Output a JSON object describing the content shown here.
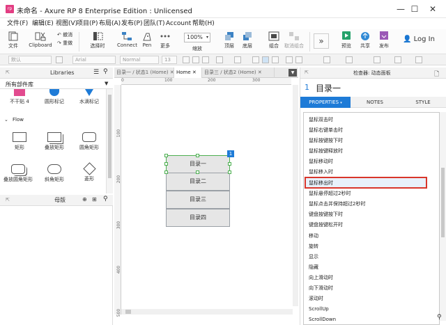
{
  "window": {
    "title": "未命名 - Axure RP 8 Enterprise Edition : Unlicensed",
    "app_icon_text": "rp",
    "minimize": "—",
    "maximize": "☐",
    "close": "✕"
  },
  "menubar": {
    "items": [
      "文件(F)",
      "编辑(E)",
      "视图(V)",
      "项目(P)",
      "布局(A)",
      "发布(P)",
      "团队(T)",
      "Account",
      "帮助(H)"
    ]
  },
  "ribbon": {
    "file": "文件",
    "clipboard": "Clipboard",
    "undo": "撤消",
    "redo": "重做",
    "select": "选择时",
    "connect": "Connect",
    "pen": "Pen",
    "more": "更多",
    "zoom_value": "100%",
    "zoom_label": "缩放",
    "top": "顶层",
    "bottom": "底层",
    "group": "组合",
    "ungroup": "取消组合",
    "preview": "预览",
    "share": "共享",
    "publish": "发布",
    "login": "Log In"
  },
  "formatbar": {
    "style": "默认",
    "font": "Arial",
    "weight": "Normal",
    "size": "13"
  },
  "libraries": {
    "title": "Libraries",
    "dropdown": "所有部件库",
    "top_items": [
      "不干贴 4",
      "圆形标记",
      "水滴标记"
    ],
    "flow_section": "Flow",
    "flow_items": [
      "矩形",
      "叠放矩形",
      "圆角矩形",
      "叠放圆角矩形",
      "斜角矩形",
      "菱形"
    ]
  },
  "masters": {
    "title": "母版"
  },
  "tabs": {
    "items": [
      "目录一 / 状态1 (Home)",
      "Home",
      "目录三 / 状态2 (Home)"
    ],
    "active_index": 1
  },
  "rulers": {
    "top": [
      "0",
      "100",
      "200",
      "300"
    ],
    "left": [
      "100",
      "200",
      "300",
      "400",
      "500"
    ]
  },
  "canvas": {
    "widgets": [
      "目录一",
      "目录二",
      "目录三",
      "目录四"
    ],
    "badge": "1"
  },
  "inspector": {
    "header": "检查器: 动态面板",
    "number": "1",
    "title": "目录一",
    "tabs": [
      "PROPERTIES",
      "NOTES",
      "STYLE"
    ],
    "events": [
      "鼠标双击时",
      "鼠标右键单击时",
      "鼠标按键按下时",
      "鼠标按键释放时",
      "鼠标移动时",
      "鼠标移入时",
      "鼠标移出时",
      "鼠标悬停超过2秒时",
      "鼠标点击并保持超过2秒时",
      "键盘按键按下时",
      "键盘按键松开时",
      "移动",
      "旋转",
      "显示",
      "隐藏",
      "向上滑动时",
      "向下滑动时",
      "滚动时",
      "ScrollUp",
      "ScrollDown"
    ],
    "selected_index": 6,
    "colors": {
      "accent": "#1e7bd7",
      "selected_border": "#d9362b",
      "selected_bg": "#e8f1fb"
    }
  }
}
